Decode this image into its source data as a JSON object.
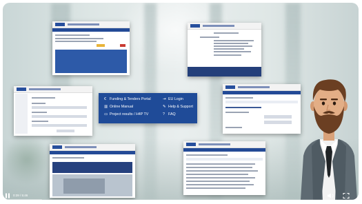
{
  "menu": {
    "items_left": [
      {
        "label": "Funding & Tenders Portal",
        "icon": "euro-icon"
      },
      {
        "label": "Online Manual",
        "icon": "book-icon"
      },
      {
        "label": "Project results / H4P TV",
        "icon": "monitor-icon"
      }
    ],
    "items_right": [
      {
        "label": "EU Login",
        "icon": "login-icon"
      },
      {
        "label": "Help & Support",
        "icon": "wrench-icon"
      },
      {
        "label": "FAQ",
        "icon": "question-icon"
      }
    ]
  },
  "player": {
    "time": "0:39 / 5:46",
    "progress": 0.11
  }
}
